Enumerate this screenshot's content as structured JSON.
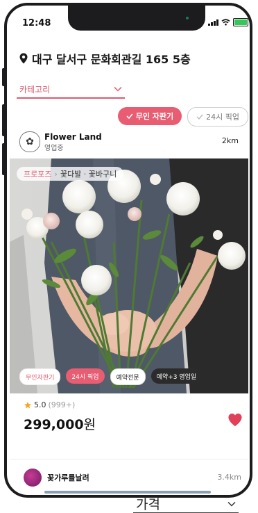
{
  "status_bar": {
    "time": "12:48"
  },
  "location": {
    "address": "대구 달서구 문화회관길 165 5층"
  },
  "filters": {
    "category_label": "카테고리",
    "price_label": "가격"
  },
  "chips": {
    "unmanned": "무인 자판기",
    "pickup_24h": "24시 픽업"
  },
  "shop": {
    "name": "Flower Land",
    "status": "영업중",
    "distance": "2km",
    "logo_icon": "flower-logo-icon"
  },
  "product": {
    "breadcrumb": [
      "프로포즈",
      "꽃다발 · 꽃바구니"
    ],
    "tags": [
      "무인자판기",
      "24시 픽업",
      "예약전문",
      "예약+3 영업일"
    ],
    "rating": "5.0",
    "review_count": "(999+)",
    "price": "299,000",
    "currency": "원",
    "wishlist_color": "#e0405a"
  },
  "next_shop": {
    "name": "꽃가루를날려",
    "distance": "3.4km"
  },
  "colors": {
    "accent": "#e85d72",
    "star": "#f5a623"
  }
}
